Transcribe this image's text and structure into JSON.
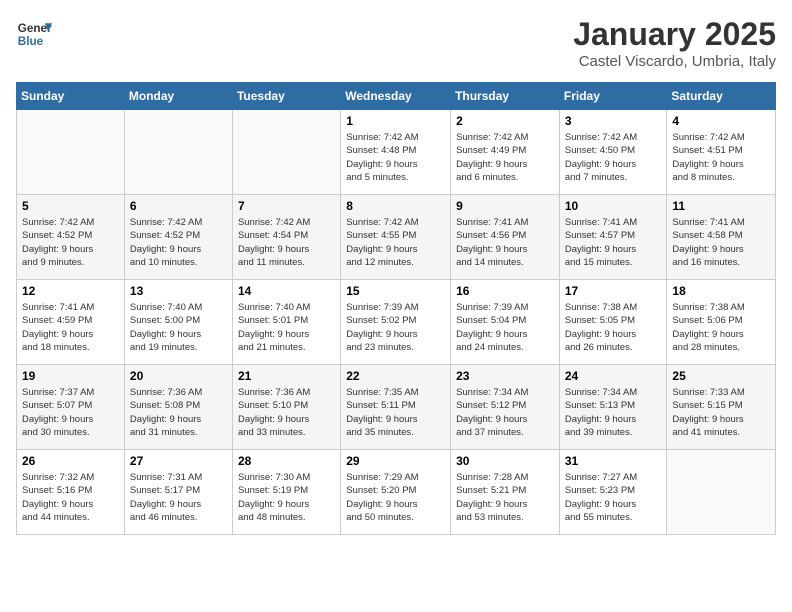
{
  "logo": {
    "general": "General",
    "blue": "Blue"
  },
  "header": {
    "month": "January 2025",
    "location": "Castel Viscardo, Umbria, Italy"
  },
  "weekdays": [
    "Sunday",
    "Monday",
    "Tuesday",
    "Wednesday",
    "Thursday",
    "Friday",
    "Saturday"
  ],
  "weeks": [
    [
      {
        "day": "",
        "info": ""
      },
      {
        "day": "",
        "info": ""
      },
      {
        "day": "",
        "info": ""
      },
      {
        "day": "1",
        "info": "Sunrise: 7:42 AM\nSunset: 4:48 PM\nDaylight: 9 hours\nand 5 minutes."
      },
      {
        "day": "2",
        "info": "Sunrise: 7:42 AM\nSunset: 4:49 PM\nDaylight: 9 hours\nand 6 minutes."
      },
      {
        "day": "3",
        "info": "Sunrise: 7:42 AM\nSunset: 4:50 PM\nDaylight: 9 hours\nand 7 minutes."
      },
      {
        "day": "4",
        "info": "Sunrise: 7:42 AM\nSunset: 4:51 PM\nDaylight: 9 hours\nand 8 minutes."
      }
    ],
    [
      {
        "day": "5",
        "info": "Sunrise: 7:42 AM\nSunset: 4:52 PM\nDaylight: 9 hours\nand 9 minutes."
      },
      {
        "day": "6",
        "info": "Sunrise: 7:42 AM\nSunset: 4:52 PM\nDaylight: 9 hours\nand 10 minutes."
      },
      {
        "day": "7",
        "info": "Sunrise: 7:42 AM\nSunset: 4:54 PM\nDaylight: 9 hours\nand 11 minutes."
      },
      {
        "day": "8",
        "info": "Sunrise: 7:42 AM\nSunset: 4:55 PM\nDaylight: 9 hours\nand 12 minutes."
      },
      {
        "day": "9",
        "info": "Sunrise: 7:41 AM\nSunset: 4:56 PM\nDaylight: 9 hours\nand 14 minutes."
      },
      {
        "day": "10",
        "info": "Sunrise: 7:41 AM\nSunset: 4:57 PM\nDaylight: 9 hours\nand 15 minutes."
      },
      {
        "day": "11",
        "info": "Sunrise: 7:41 AM\nSunset: 4:58 PM\nDaylight: 9 hours\nand 16 minutes."
      }
    ],
    [
      {
        "day": "12",
        "info": "Sunrise: 7:41 AM\nSunset: 4:59 PM\nDaylight: 9 hours\nand 18 minutes."
      },
      {
        "day": "13",
        "info": "Sunrise: 7:40 AM\nSunset: 5:00 PM\nDaylight: 9 hours\nand 19 minutes."
      },
      {
        "day": "14",
        "info": "Sunrise: 7:40 AM\nSunset: 5:01 PM\nDaylight: 9 hours\nand 21 minutes."
      },
      {
        "day": "15",
        "info": "Sunrise: 7:39 AM\nSunset: 5:02 PM\nDaylight: 9 hours\nand 23 minutes."
      },
      {
        "day": "16",
        "info": "Sunrise: 7:39 AM\nSunset: 5:04 PM\nDaylight: 9 hours\nand 24 minutes."
      },
      {
        "day": "17",
        "info": "Sunrise: 7:38 AM\nSunset: 5:05 PM\nDaylight: 9 hours\nand 26 minutes."
      },
      {
        "day": "18",
        "info": "Sunrise: 7:38 AM\nSunset: 5:06 PM\nDaylight: 9 hours\nand 28 minutes."
      }
    ],
    [
      {
        "day": "19",
        "info": "Sunrise: 7:37 AM\nSunset: 5:07 PM\nDaylight: 9 hours\nand 30 minutes."
      },
      {
        "day": "20",
        "info": "Sunrise: 7:36 AM\nSunset: 5:08 PM\nDaylight: 9 hours\nand 31 minutes."
      },
      {
        "day": "21",
        "info": "Sunrise: 7:36 AM\nSunset: 5:10 PM\nDaylight: 9 hours\nand 33 minutes."
      },
      {
        "day": "22",
        "info": "Sunrise: 7:35 AM\nSunset: 5:11 PM\nDaylight: 9 hours\nand 35 minutes."
      },
      {
        "day": "23",
        "info": "Sunrise: 7:34 AM\nSunset: 5:12 PM\nDaylight: 9 hours\nand 37 minutes."
      },
      {
        "day": "24",
        "info": "Sunrise: 7:34 AM\nSunset: 5:13 PM\nDaylight: 9 hours\nand 39 minutes."
      },
      {
        "day": "25",
        "info": "Sunrise: 7:33 AM\nSunset: 5:15 PM\nDaylight: 9 hours\nand 41 minutes."
      }
    ],
    [
      {
        "day": "26",
        "info": "Sunrise: 7:32 AM\nSunset: 5:16 PM\nDaylight: 9 hours\nand 44 minutes."
      },
      {
        "day": "27",
        "info": "Sunrise: 7:31 AM\nSunset: 5:17 PM\nDaylight: 9 hours\nand 46 minutes."
      },
      {
        "day": "28",
        "info": "Sunrise: 7:30 AM\nSunset: 5:19 PM\nDaylight: 9 hours\nand 48 minutes."
      },
      {
        "day": "29",
        "info": "Sunrise: 7:29 AM\nSunset: 5:20 PM\nDaylight: 9 hours\nand 50 minutes."
      },
      {
        "day": "30",
        "info": "Sunrise: 7:28 AM\nSunset: 5:21 PM\nDaylight: 9 hours\nand 53 minutes."
      },
      {
        "day": "31",
        "info": "Sunrise: 7:27 AM\nSunset: 5:23 PM\nDaylight: 9 hours\nand 55 minutes."
      },
      {
        "day": "",
        "info": ""
      }
    ]
  ]
}
